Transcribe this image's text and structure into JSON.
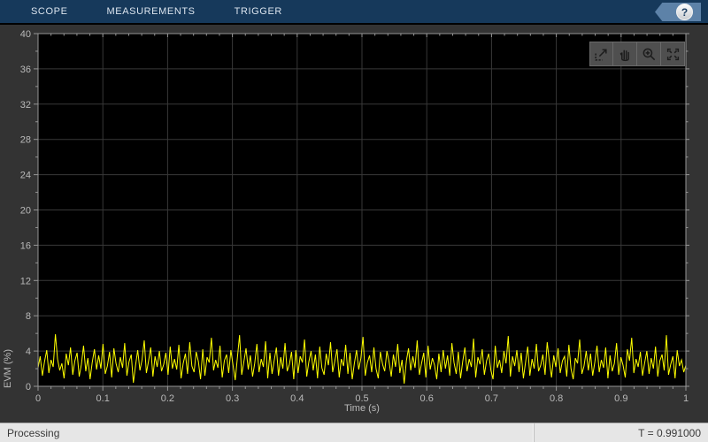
{
  "tabs": [
    {
      "label": "SCOPE"
    },
    {
      "label": "MEASUREMENTS"
    },
    {
      "label": "TRIGGER"
    }
  ],
  "help": {
    "label": "?"
  },
  "plot_toolbar": {
    "buttons": [
      {
        "name": "export-to-figure"
      },
      {
        "name": "pan"
      },
      {
        "name": "zoom-in"
      },
      {
        "name": "fit-to-view"
      }
    ]
  },
  "status_bar": {
    "left": "Processing",
    "right": "T = 0.991000"
  },
  "colors": {
    "tabbar_bg": "#16395b",
    "window_bg": "#333333",
    "plot_bg": "#000000",
    "frame": "#969696",
    "grid": "#383838",
    "tick_label": "#b9b9b9",
    "trace": "#ffff00",
    "statusbar_bg": "#e6e6e6"
  },
  "chart_data": {
    "type": "line",
    "title": "",
    "xlabel": "Time (s)",
    "ylabel": "EVM (%)",
    "xlim": [
      0,
      1
    ],
    "ylim": [
      0,
      40
    ],
    "x_ticks": [
      0,
      0.1,
      0.2,
      0.3,
      0.4,
      0.5,
      0.6,
      0.7,
      0.8,
      0.9,
      1
    ],
    "x_tick_labels": [
      "0",
      "0.1",
      "0.2",
      "0.3",
      "0.4",
      "0.5",
      "0.6",
      "0.7",
      "0.8",
      "0.9",
      "1"
    ],
    "y_ticks": [
      0,
      4,
      8,
      12,
      16,
      20,
      24,
      28,
      32,
      36,
      40
    ],
    "y_tick_labels": [
      "0",
      "4",
      "8",
      "12",
      "16",
      "20",
      "24",
      "28",
      "32",
      "36",
      "40"
    ],
    "grid": true,
    "legend": null,
    "signal_stats": {
      "mean": 2.5,
      "min": 0.3,
      "max": 5.9
    },
    "series": [
      {
        "name": "EVM",
        "color": "#ffff00",
        "values": [
          2.1,
          3.4,
          1.2,
          2.8,
          4.1,
          1.5,
          3.0,
          2.2,
          5.9,
          3.1,
          1.8,
          2.6,
          0.9,
          3.7,
          2.4,
          4.4,
          1.3,
          2.9,
          3.8,
          1.1,
          2.5,
          4.6,
          1.7,
          3.2,
          0.8,
          2.7,
          4.2,
          1.9,
          3.5,
          2.0,
          4.8,
          1.4,
          2.3,
          3.9,
          1.0,
          4.3,
          2.6,
          1.6,
          3.3,
          2.1,
          4.9,
          1.2,
          2.8,
          3.6,
          0.4,
          2.4,
          4.1,
          1.8,
          3.0,
          5.2,
          1.5,
          2.9,
          4.4,
          1.1,
          3.4,
          2.2,
          4.0,
          1.7,
          2.5,
          3.8,
          1.3,
          4.5,
          2.0,
          3.1,
          1.9,
          4.7,
          0.9,
          2.6,
          3.7,
          1.4,
          5.0,
          2.3,
          1.6,
          3.9,
          2.8,
          0.8,
          4.2,
          1.2,
          3.3,
          2.7,
          5.5,
          1.8,
          3.0,
          2.1,
          4.6,
          1.0,
          2.9,
          3.6,
          1.5,
          4.1,
          2.4,
          0.7,
          3.2,
          5.8,
          1.3,
          2.8,
          4.3,
          1.9,
          3.5,
          1.1,
          2.6,
          4.8,
          1.6,
          3.1,
          2.2,
          5.1,
          0.9,
          3.8,
          1.4,
          2.9,
          4.4,
          1.2,
          3.3,
          2.0,
          4.9,
          1.7,
          2.5,
          3.9,
          0.8,
          4.1,
          1.5,
          3.4,
          2.7,
          5.3,
          1.1,
          2.8,
          4.0,
          1.8,
          3.6,
          0.9,
          4.5,
          2.1,
          1.3,
          3.7,
          2.4,
          5.0,
          1.6,
          2.9,
          4.2,
          1.0,
          3.1,
          2.3,
          4.7,
          1.4,
          3.8,
          0.8,
          2.6,
          4.1,
          1.9,
          3.2,
          5.6,
          1.2,
          2.7,
          3.5,
          1.6,
          4.4,
          2.0,
          0.9,
          3.9,
          2.5,
          1.7,
          4.0,
          2.8,
          1.1,
          3.6,
          2.2,
          4.8,
          1.5,
          3.0,
          0.3,
          2.9,
          4.3,
          1.8,
          3.4,
          2.1,
          5.2,
          1.3,
          2.6,
          3.8,
          1.0,
          4.6,
          1.9,
          3.2,
          2.4,
          0.8,
          3.7,
          1.6,
          4.1,
          2.0,
          3.5,
          1.2,
          4.9,
          2.7,
          1.4,
          3.9,
          0.9,
          2.8,
          4.4,
          1.7,
          3.1,
          2.2,
          5.4,
          1.0,
          3.3,
          2.5,
          4.2,
          1.3,
          2.9,
          3.7,
          1.8,
          0.8,
          4.6,
          2.1,
          3.0,
          1.5,
          4.0,
          2.6,
          5.7,
          1.1,
          3.4,
          2.3,
          4.1,
          1.6,
          3.8,
          0.9,
          2.7,
          4.5,
          1.2,
          3.1,
          2.0,
          4.8,
          1.7,
          2.4,
          3.6,
          1.3,
          5.0,
          2.8,
          1.0,
          3.5,
          2.2,
          4.3,
          1.5,
          2.9,
          3.4,
          1.1,
          4.7,
          2.0,
          0.8,
          3.2,
          2.6,
          5.3,
          1.4,
          2.3,
          4.0,
          1.8,
          3.7,
          1.2,
          2.8,
          4.6,
          1.6,
          3.0,
          2.1,
          4.4,
          0.9,
          3.5,
          1.7,
          2.6,
          4.9,
          1.3,
          3.3,
          2.4,
          1.0,
          4.2,
          2.9,
          5.5,
          1.5,
          3.1,
          2.2,
          3.9,
          1.2,
          2.7,
          4.0,
          1.4,
          3.2,
          2.0,
          4.5,
          1.1,
          2.9,
          3.6,
          1.8,
          5.8,
          1.3,
          2.5,
          3.4,
          0.9,
          4.1,
          2.3,
          3.0,
          1.6,
          2.4
        ]
      }
    ]
  }
}
